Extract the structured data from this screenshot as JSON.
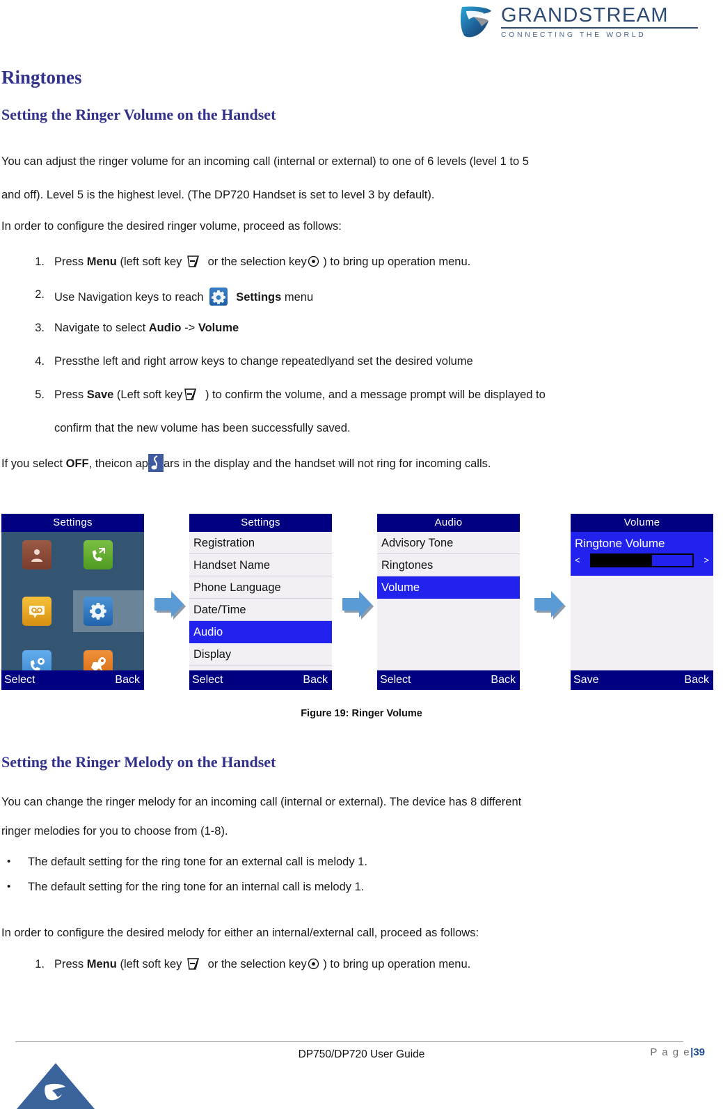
{
  "header": {
    "brand": "GRANDSTREAM",
    "tagline": "CONNECTING THE WORLD",
    "logo_icon": "grandstream-swoosh-icon"
  },
  "headings": {
    "section": "Ringtones",
    "sub_volume": "Setting the Ringer Volume on the Handset",
    "sub_melody": "Setting the Ringer Melody on the Handset"
  },
  "volume_section": {
    "para1": "You can adjust the ringer volume for an incoming call (internal or external) to one of 6 levels (level 1 to 5",
    "para2": "and off). Level 5 is the highest level. (The DP720 Handset is set to level 3 by default).",
    "para3": "In order to configure the desired ringer volume, proceed as follows:",
    "steps": [
      {
        "num": "1.",
        "pre": "Press ",
        "bold": "Menu",
        "mid": " (left soft key ",
        "mid2": " or the selection key",
        "post": " ) to bring up operation menu."
      },
      {
        "num": "2.",
        "pre": "Use Navigation keys to reach ",
        "bold": "Settings",
        "post": " menu"
      },
      {
        "num": "3.",
        "pre": "Navigate to select ",
        "bold": "Audio",
        "mid": " -> ",
        "bold2": "Volume"
      },
      {
        "num": "4.",
        "pre": "Pressthe left and right arrow keys to change repeatedlyand set the desired volume"
      },
      {
        "num": "5.",
        "pre": "Press ",
        "bold": "Save",
        "mid": " (Left soft key",
        "post": " ) to confirm the volume, and a message prompt will be displayed to",
        "line2": "confirm that the new volume has been successfully saved."
      }
    ],
    "off_note_pre": "If you select ",
    "off_note_bold": "OFF",
    "off_note_mid": ", theicon ap",
    "off_note_post": "ars in the display and the handset will not ring for incoming calls."
  },
  "figure": {
    "caption": "Figure 19: Ringer Volume",
    "screens": [
      {
        "name": "settings-grid",
        "title": "Settings",
        "softkey_left": "Select",
        "softkey_right": "Back",
        "icons": [
          {
            "name": "contacts-icon",
            "glyph": "☰",
            "color": "#8a4a3a",
            "label": "Contacts"
          },
          {
            "name": "call-history-icon",
            "glyph": "✆",
            "color": "#5aa832",
            "label": "Call History"
          },
          {
            "name": "voicemail-icon",
            "glyph": "✉",
            "color": "#e0a01c",
            "label": "Voice Mail"
          },
          {
            "name": "settings-icon",
            "glyph": "⚙",
            "color": "#2f7ec4",
            "label": "Settings"
          },
          {
            "name": "call-settings-icon",
            "glyph": "☎",
            "color": "#4e9ae0",
            "label": "Call Settings"
          },
          {
            "name": "shortcut-icon",
            "glyph": "★",
            "color": "#e8802a",
            "label": "Shortcut"
          }
        ],
        "selected_index": 3
      },
      {
        "name": "settings-list",
        "title": "Settings",
        "softkey_left": "Select",
        "softkey_right": "Back",
        "items": [
          "Registration",
          "Handset Name",
          "Phone Language",
          "Date/Time",
          "Audio",
          "Display"
        ],
        "selected": "Audio"
      },
      {
        "name": "audio-list",
        "title": "Audio",
        "softkey_left": "Select",
        "softkey_right": "Back",
        "items": [
          "Advisory Tone",
          "Ringtones",
          "Volume"
        ],
        "selected": "Volume"
      },
      {
        "name": "volume-screen",
        "title": "Volume",
        "softkey_left": "Save",
        "softkey_right": "Back",
        "slider_label": "Ringtone Volume",
        "slider_left_arrow": "<",
        "slider_right_arrow": ">",
        "slider_percent": 60
      }
    ],
    "arrow_icon": "arrow-right-icon"
  },
  "melody_section": {
    "para1": "You can change the ringer melody for an incoming call (internal or external). The device has 8 different",
    "para2": "ringer melodies for you to choose from (1-8).",
    "bullets": [
      "The default setting for the ring tone for an external call is melody 1.",
      "The default setting for the ring tone for an internal call is melody 1."
    ],
    "para3": "In order to configure the desired melody for either an internal/external call, proceed as follows:",
    "step1": {
      "num": "1.",
      "pre": "Press ",
      "bold": "Menu",
      "mid": " (left soft key ",
      "mid2": " or the selection key",
      "post": " ) to bring up operation menu."
    }
  },
  "footer": {
    "doc_title": "DP750/DP720 User Guide",
    "page_label": "P a g e",
    "page_sep": "|",
    "page_number": "39",
    "logo_icon": "grandstream-triangle-logo"
  },
  "colors": {
    "heading": "#32328c",
    "brand": "#2c4a72",
    "screen_titlebar": "#000080",
    "screen_selected": "#2222ee",
    "arrow": "#5b9bd5"
  }
}
